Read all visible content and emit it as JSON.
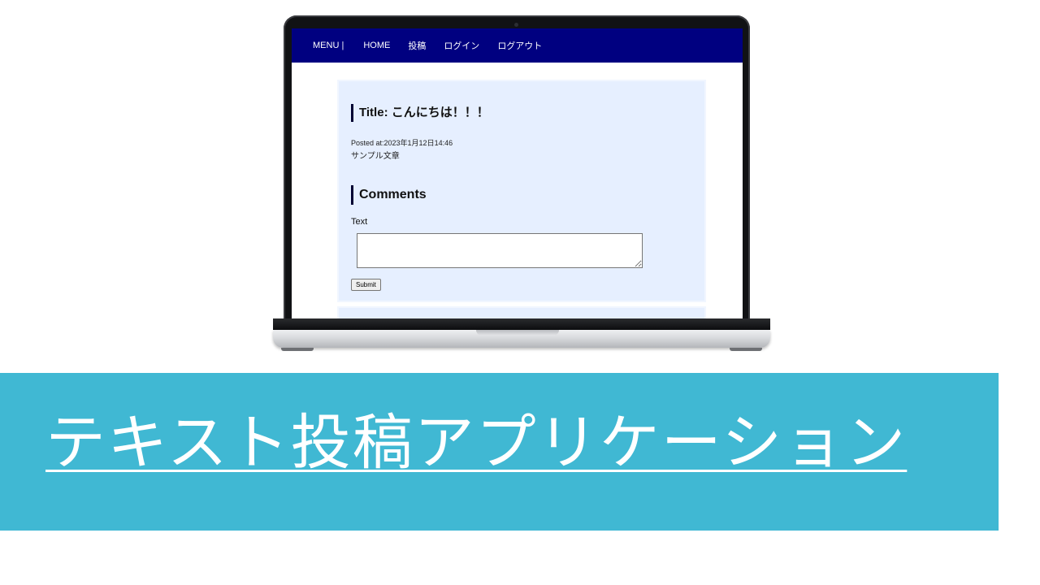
{
  "nav": {
    "menu_label": "MENU |",
    "items": [
      {
        "label": "HOME"
      },
      {
        "label": "投稿"
      },
      {
        "label": "ログイン"
      },
      {
        "label": "ログアウト"
      }
    ]
  },
  "post": {
    "title": "Title: こんにちは！！！",
    "posted_at": "Posted at:2023年1月12日14:46",
    "body": "サンプル文章"
  },
  "comments": {
    "heading": "Comments",
    "text_label": "Text",
    "textarea_value": "",
    "submit_label": "Submit"
  },
  "banner": {
    "title": "テキスト投稿アプリケーション"
  },
  "colors": {
    "navbar": "#000080",
    "card_background": "#e6efff",
    "banner_background": "#40b8d3"
  }
}
